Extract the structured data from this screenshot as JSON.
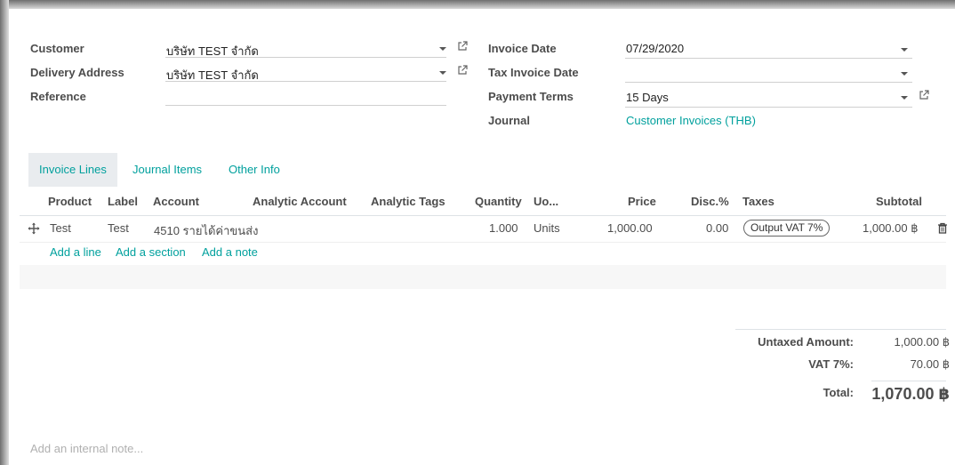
{
  "header": {
    "customer_label": "Customer",
    "customer_value": "บริษัท TEST จำกัด",
    "delivery_label": "Delivery Address",
    "delivery_value": "บริษัท TEST จำกัด",
    "reference_label": "Reference",
    "reference_value": "",
    "invoice_date_label": "Invoice Date",
    "invoice_date_value": "07/29/2020",
    "tax_invoice_date_label": "Tax Invoice Date",
    "tax_invoice_date_value": "",
    "payment_terms_label": "Payment Terms",
    "payment_terms_value": "15 Days",
    "journal_label": "Journal",
    "journal_value": "Customer Invoices (THB)"
  },
  "tabs": [
    {
      "label": "Invoice Lines",
      "active": true
    },
    {
      "label": "Journal Items",
      "active": false
    },
    {
      "label": "Other Info",
      "active": false
    }
  ],
  "columns": {
    "product": "Product",
    "label": "Label",
    "account": "Account",
    "analytic_account": "Analytic Account",
    "analytic_tags": "Analytic Tags",
    "quantity": "Quantity",
    "uom": "Uo...",
    "price": "Price",
    "disc": "Disc.%",
    "taxes": "Taxes",
    "subtotal": "Subtotal"
  },
  "lines": [
    {
      "product": "Test",
      "label": "Test",
      "account": "4510 รายได้ค่าขนส่ง",
      "quantity": "1.000",
      "uom": "Units",
      "price": "1,000.00",
      "disc": "0.00",
      "tax": "Output VAT 7%",
      "subtotal": "1,000.00 ฿"
    }
  ],
  "actions": {
    "add_line": "Add a line",
    "add_section": "Add a section",
    "add_note": "Add a note"
  },
  "totals": {
    "untaxed_label": "Untaxed Amount:",
    "untaxed_value": "1,000.00 ฿",
    "vat_label": "VAT 7%:",
    "vat_value": "70.00 ฿",
    "total_label": "Total:",
    "total_value": "1,070.00 ฿"
  },
  "internal_note_placeholder": "Add an internal note...",
  "colors": {
    "accent": "#00A09D",
    "label": "#4c4c4c",
    "border": "#dee2e6"
  }
}
